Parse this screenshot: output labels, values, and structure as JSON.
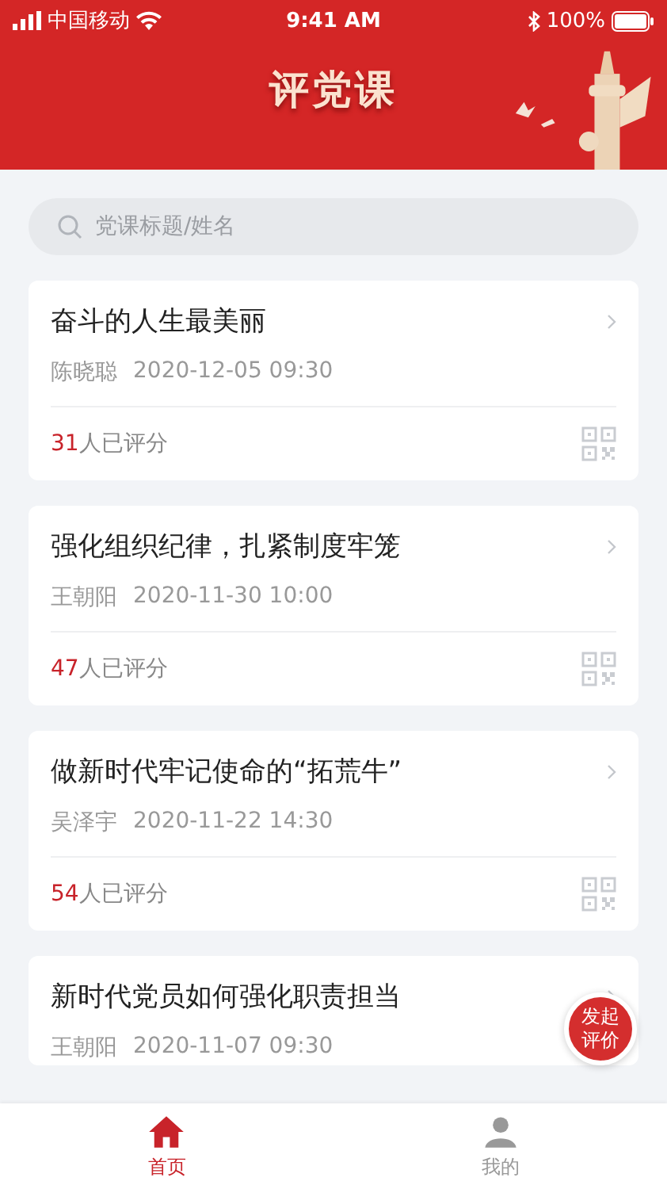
{
  "status_bar": {
    "carrier": "中国移动",
    "time": "9:41 AM",
    "battery": "100%"
  },
  "header": {
    "title": "评党课"
  },
  "search": {
    "placeholder": "党课标题/姓名"
  },
  "lessons": [
    {
      "title": "奋斗的人生最美丽",
      "author": "陈晓聪",
      "datetime": "2020-12-05 09:30",
      "count": "31",
      "count_suffix": "人已评分"
    },
    {
      "title": "强化组织纪律，扎紧制度牢笼",
      "author": "王朝阳",
      "datetime": "2020-11-30 10:00",
      "count": "47",
      "count_suffix": "人已评分"
    },
    {
      "title": "做新时代牢记使命的“拓荒牛”",
      "author": "吴泽宇",
      "datetime": "2020-11-22 14:30",
      "count": "54",
      "count_suffix": "人已评分"
    },
    {
      "title": "新时代党员如何强化职责担当",
      "author": "王朝阳",
      "datetime": "2020-11-07 09:30"
    }
  ],
  "fab": {
    "label": "发起评价"
  },
  "tabs": [
    {
      "label": "首页",
      "selected": true
    },
    {
      "label": "我的",
      "selected": false
    }
  ]
}
